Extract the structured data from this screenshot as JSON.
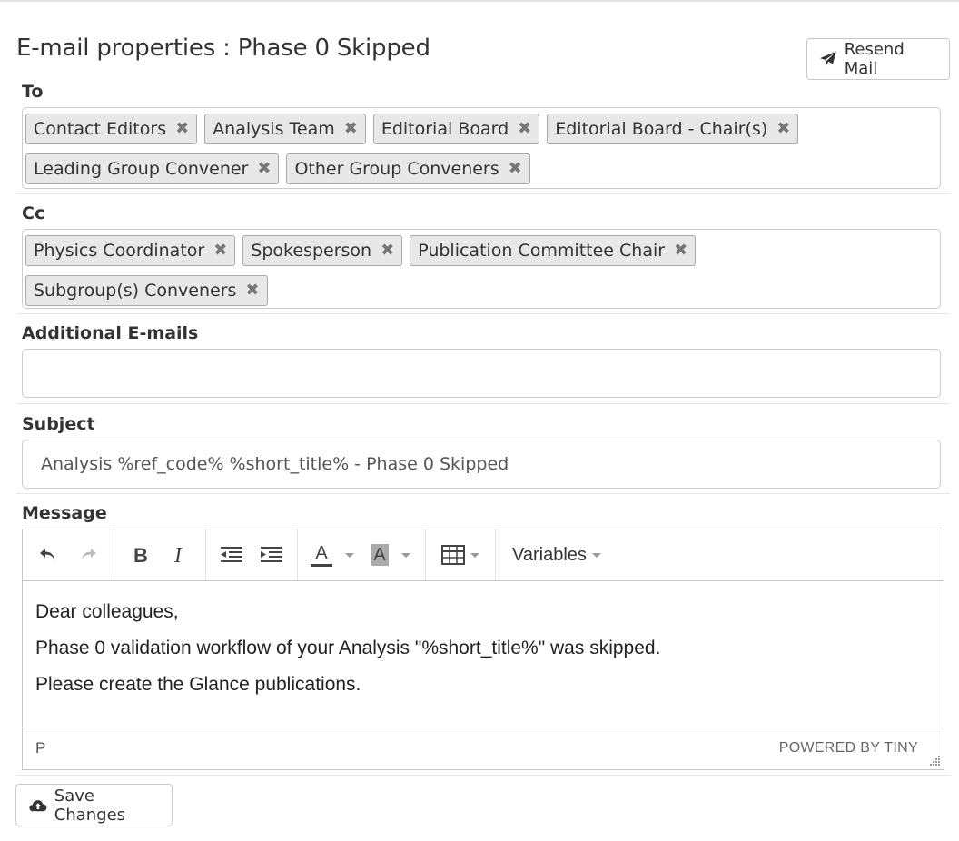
{
  "page": {
    "title": "E-mail properties : Phase 0 Skipped",
    "resend_label": "Resend Mail",
    "save_label": "Save Changes"
  },
  "to": {
    "label": "To",
    "tags": [
      "Contact Editors",
      "Analysis Team",
      "Editorial Board",
      "Editorial Board - Chair(s)",
      "Leading Group Convener",
      "Other Group Conveners"
    ]
  },
  "cc": {
    "label": "Cc",
    "tags": [
      "Physics Coordinator",
      "Spokesperson",
      "Publication Committee Chair",
      "Subgroup(s) Conveners"
    ]
  },
  "additional": {
    "label": "Additional E-mails",
    "value": ""
  },
  "subject": {
    "label": "Subject",
    "value": "Analysis %ref_code%  %short_title% - Phase 0 Skipped"
  },
  "message": {
    "label": "Message",
    "variables_label": "Variables",
    "paragraphs": [
      "Dear colleagues,",
      "Phase 0 validation workflow of your Analysis \"%short_title%\" was skipped.",
      "Please create the Glance publications."
    ],
    "status_path": "P",
    "powered_by": "POWERED BY TINY"
  },
  "icons": {
    "remove_glyph": "✖",
    "text_color_glyph": "A",
    "bg_color_glyph": "A"
  }
}
